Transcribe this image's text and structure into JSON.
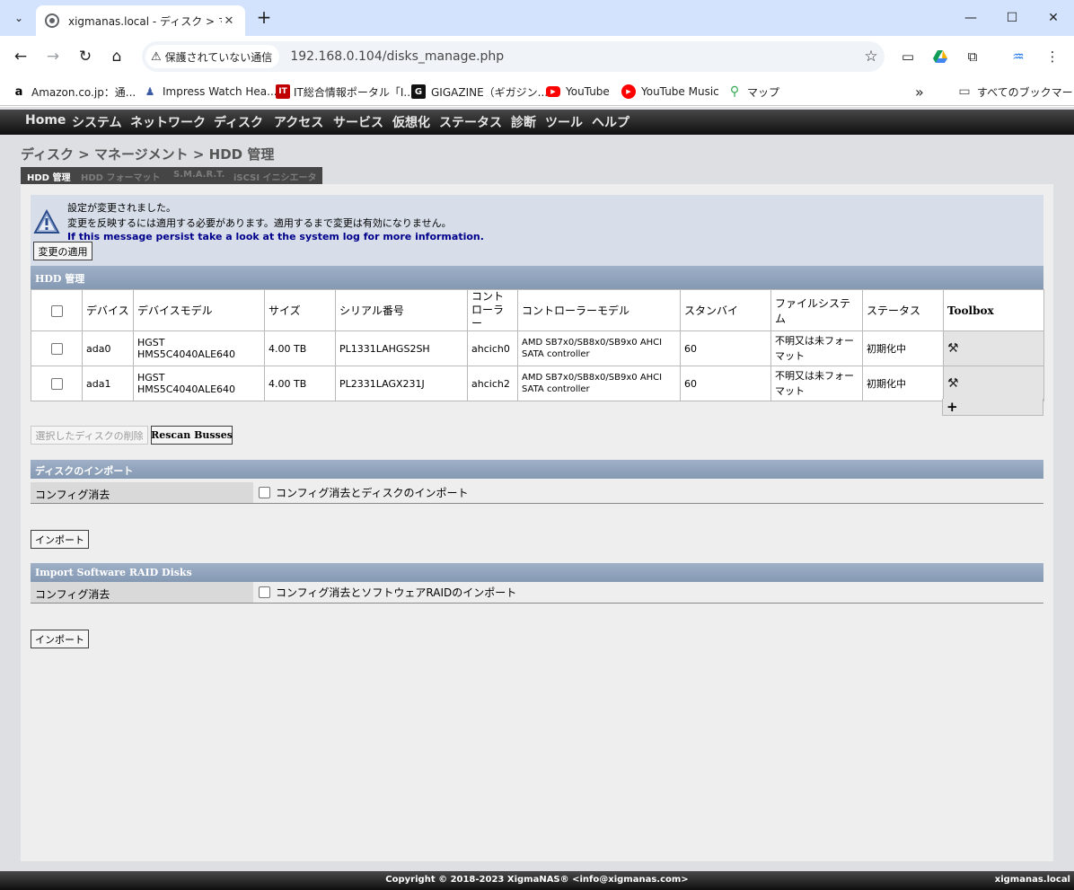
{
  "browser": {
    "tab_title": "xigmanas.local - ディスク > マネー",
    "security_label": "保護されていない通信",
    "url": "192.168.0.104/disks_manage.php",
    "bookmarks": [
      {
        "label": "Amazon.co.jp：通...",
        "icon": "amazon-icon"
      },
      {
        "label": "Impress Watch Hea...",
        "icon": "impress-icon"
      },
      {
        "label": "IT総合情報ポータル「I...",
        "icon": "itmedia-icon"
      },
      {
        "label": "GIGAZINE（ギガジン...",
        "icon": "gigazine-icon"
      },
      {
        "label": "YouTube",
        "icon": "youtube-icon"
      },
      {
        "label": "YouTube Music",
        "icon": "youtube-music-icon"
      },
      {
        "label": "マップ",
        "icon": "maps-icon"
      }
    ],
    "all_bookmarks": "すべてのブックマーク"
  },
  "nav": [
    "Home",
    "システム",
    "ネットワーク",
    "ディスク",
    "アクセス",
    "サービス",
    "仮想化",
    "ステータス",
    "診断",
    "ツール",
    "ヘルプ"
  ],
  "breadcrumb": "ディスク > マネージメント > HDD 管理",
  "subtabs": [
    "HDD 管理",
    "HDD フォーマット",
    "S.M.A.R.T.",
    "iSCSI イニシエータ"
  ],
  "message": {
    "line1": "設定が変更されました。",
    "line2": "変更を反映するには適用する必要があります。適用するまで変更は有効になりません。",
    "line3": "If this message persist take a look at the system log for more information.",
    "apply_button": "変更の適用"
  },
  "hdd_section": {
    "title": "HDD 管理",
    "columns": [
      "デバイス",
      "デバイスモデル",
      "サイズ",
      "シリアル番号",
      "コントローラー",
      "コントローラーモデル",
      "スタンバイ",
      "ファイルシステム",
      "ステータス",
      "Toolbox"
    ],
    "rows": [
      {
        "device": "ada0",
        "model": "HGST HMS5C4040ALE640",
        "size": "4.00 TB",
        "serial": "PL1331LAHGS2SH",
        "controller": "ahcich0",
        "controller_model": "AMD SB7x0/SB8x0/SB9x0 AHCI SATA controller",
        "standby": "60",
        "filesystem": "不明又は未フォーマット",
        "status": "初期化中"
      },
      {
        "device": "ada1",
        "model": "HGST HMS5C4040ALE640",
        "size": "4.00 TB",
        "serial": "PL2331LAGX231J",
        "controller": "ahcich2",
        "controller_model": "AMD SB7x0/SB8x0/SB9x0 AHCI SATA controller",
        "standby": "60",
        "filesystem": "不明又は未フォーマット",
        "status": "初期化中"
      }
    ],
    "delete_button": "選択したディスクの削除",
    "rescan_button": "Rescan Busses"
  },
  "import_disks": {
    "title": "ディスクのインポート",
    "label": "コンフィグ消去",
    "checkbox_label": "コンフィグ消去とディスクのインポート",
    "button": "インポート"
  },
  "import_raid": {
    "title": "Import Software RAID Disks",
    "label": "コンフィグ消去",
    "checkbox_label": "コンフィグ消去とソフトウェアRAIDのインポート",
    "button": "インポート"
  },
  "footer": {
    "copyright": "Copyright © 2018-2023 XigmaNAS® <info@xigmanas.com>",
    "host": "xigmanas.local"
  }
}
